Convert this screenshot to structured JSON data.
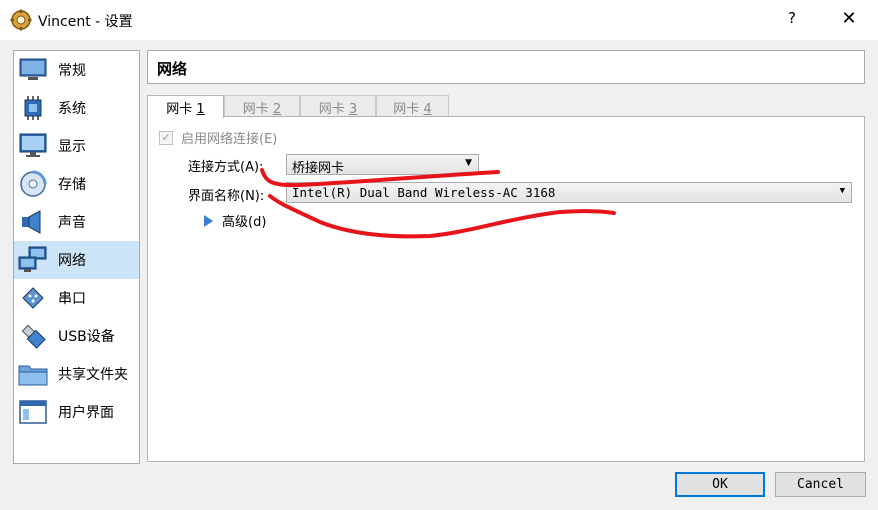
{
  "window": {
    "title": "Vincent - 设置",
    "help": "?",
    "close": "✕"
  },
  "sidebar": {
    "items": [
      {
        "label": "常规",
        "icon": "monitor-icon"
      },
      {
        "label": "系统",
        "icon": "chip-icon"
      },
      {
        "label": "显示",
        "icon": "display-icon"
      },
      {
        "label": "存储",
        "icon": "disk-icon"
      },
      {
        "label": "声音",
        "icon": "speaker-icon"
      },
      {
        "label": "网络",
        "icon": "network-icon"
      },
      {
        "label": "串口",
        "icon": "serial-port-icon"
      },
      {
        "label": "USB设备",
        "icon": "usb-icon"
      },
      {
        "label": "共享文件夹",
        "icon": "folder-icon"
      },
      {
        "label": "用户界面",
        "icon": "window-icon"
      }
    ],
    "active_index": 5
  },
  "page": {
    "title": "网络"
  },
  "tabs": [
    {
      "label": "网卡 ",
      "num": "1"
    },
    {
      "label": "网卡 ",
      "num": "2"
    },
    {
      "label": "网卡 ",
      "num": "3"
    },
    {
      "label": "网卡 ",
      "num": "4"
    }
  ],
  "form": {
    "enable_label": "启用网络连接(E)",
    "attached_label": "连接方式(A):",
    "attached_value": "桥接网卡",
    "name_label": "界面名称(N):",
    "name_value": "Intel(R) Dual Band Wireless-AC 3168",
    "advanced_label": "高级(d)"
  },
  "buttons": {
    "ok": "OK",
    "cancel": "Cancel"
  },
  "colors": {
    "accent": "#0078d7",
    "selection": "#cce4f7",
    "annotation_red": "#e8141b"
  }
}
